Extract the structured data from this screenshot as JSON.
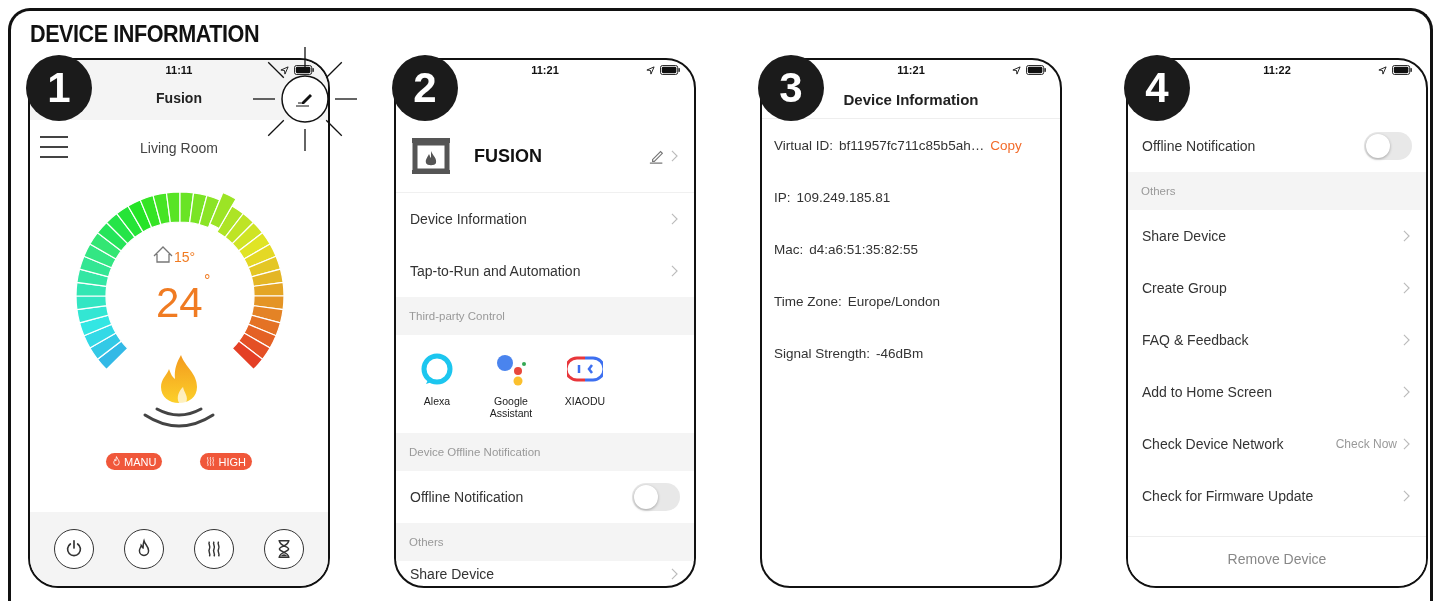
{
  "title": "DEVICE INFORMATION",
  "phones": [
    {
      "kind": "thermostat",
      "step": "1",
      "time": "11:11",
      "title": "Fusion",
      "room": "Living Room",
      "indoor_temp": "15°",
      "set_temp": "24",
      "unit": "°",
      "level": 0.59,
      "modes": [
        {
          "kind": "flame",
          "label": "MANU"
        },
        {
          "kind": "heat",
          "label": "HIGH"
        }
      ],
      "controls": [
        {
          "kind": "power"
        },
        {
          "kind": "flame"
        },
        {
          "kind": "heat"
        },
        {
          "kind": "timer"
        }
      ]
    },
    {
      "kind": "settings",
      "step": "2",
      "time": "11:21",
      "items": [
        {
          "kind": "device",
          "label": "FUSION"
        },
        {
          "kind": "link",
          "label": "Device Information"
        },
        {
          "kind": "link",
          "label": "Tap-to-Run and Automation"
        },
        {
          "kind": "section",
          "label": "Third-party Control"
        },
        {
          "kind": "apps",
          "apps": [
            {
              "kind": "alexa",
              "label": "Alexa"
            },
            {
              "kind": "google",
              "label": "Google Assistant"
            },
            {
              "kind": "xiaodu",
              "label": "XIAODU"
            }
          ]
        },
        {
          "kind": "section",
          "label": "Device Offline Notification"
        },
        {
          "kind": "toggle",
          "label": "Offline Notification",
          "on": false
        },
        {
          "kind": "section",
          "label": "Others"
        },
        {
          "kind": "link",
          "label": "Share Device"
        }
      ]
    },
    {
      "kind": "info",
      "step": "3",
      "time": "11:21",
      "title": "Device Information",
      "rows": [
        {
          "label": "Virtual ID:",
          "value": "bf11957fc711c85b5ah…",
          "action": "Copy"
        },
        {
          "label": "IP:",
          "value": "109.249.185.81"
        },
        {
          "label": "Mac:",
          "value": "d4:a6:51:35:82:55"
        },
        {
          "label": "Time Zone:",
          "value": "Europe/London"
        },
        {
          "label": "Signal Strength:",
          "value": "-46dBm"
        }
      ]
    },
    {
      "kind": "settings",
      "step": "4",
      "time": "11:22",
      "items": [
        {
          "kind": "toggle",
          "label": "Offline Notification",
          "on": false
        },
        {
          "kind": "section",
          "label": "Others"
        },
        {
          "kind": "link",
          "label": "Share Device"
        },
        {
          "kind": "link",
          "label": "Create Group"
        },
        {
          "kind": "link",
          "label": "FAQ & Feedback"
        },
        {
          "kind": "link",
          "label": "Add to Home Screen"
        },
        {
          "kind": "link",
          "label": "Check Device Network",
          "value": "Check Now"
        },
        {
          "kind": "link",
          "label": "Check for Firmware Update"
        },
        {
          "kind": "button",
          "label": "Remove Device"
        }
      ]
    }
  ]
}
